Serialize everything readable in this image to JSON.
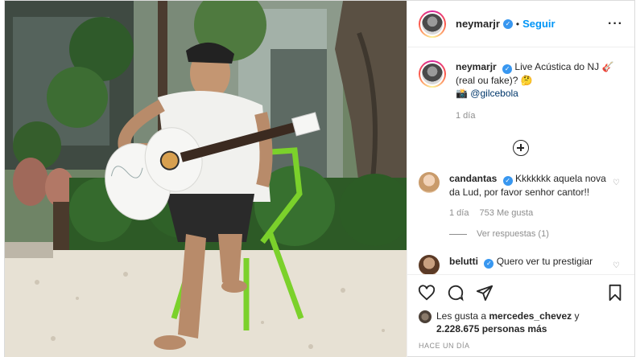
{
  "header": {
    "username": "neymarjr",
    "verified_mark": "✓",
    "separator": "•",
    "follow_label": "Seguir",
    "more_label": "···"
  },
  "caption": {
    "username": "neymarjr",
    "text_1": "Live Acústica do NJ 🎸",
    "text_2": "(real ou fake)? 🤔",
    "mention_prefix": "📸",
    "mention": "@gilcebola",
    "time": "1 día"
  },
  "comments": [
    {
      "username": "candantas",
      "text": "Kkkkkkk aquela nova da Lud, por favor senhor cantor!!",
      "time": "1 día",
      "likes": "753 Me gusta",
      "replies_label": "Ver respuestas (1)"
    },
    {
      "username": "belutti",
      "text": "Quero ver tu prestigiar"
    }
  ],
  "likes": {
    "prefix": "Les gusta a ",
    "user": "mercedes_chevez",
    "middle": " y",
    "count": "2.228.675 personas más"
  },
  "timestamp": "Hace un día",
  "icons": [
    "heart-icon",
    "comment-icon",
    "share-icon",
    "bookmark-icon",
    "add-comment-icon",
    "like-comment-icon"
  ]
}
